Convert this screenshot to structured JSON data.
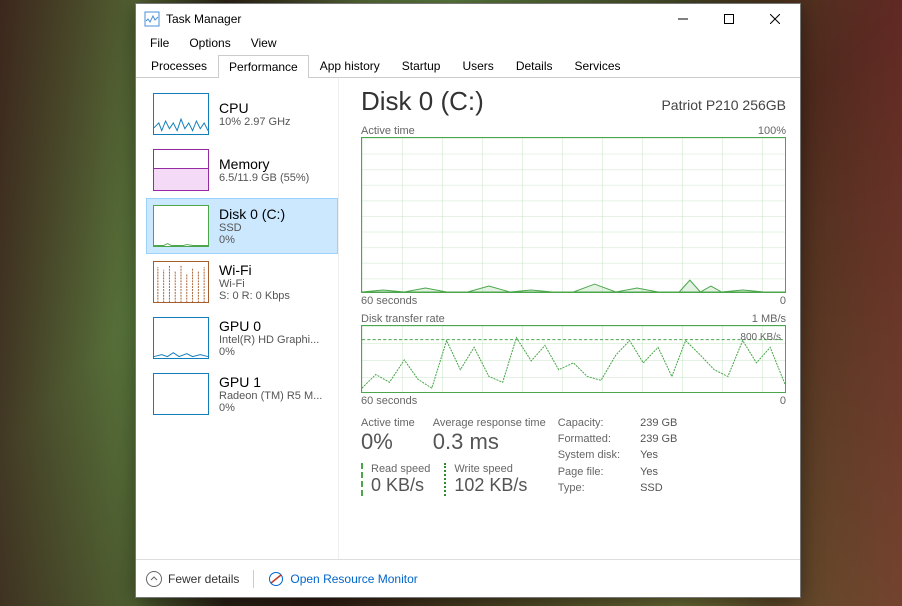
{
  "window": {
    "title": "Task Manager"
  },
  "menus": [
    "File",
    "Options",
    "View"
  ],
  "tabs": [
    "Processes",
    "Performance",
    "App history",
    "Startup",
    "Users",
    "Details",
    "Services"
  ],
  "active_tab": 1,
  "sidebar": {
    "items": [
      {
        "title": "CPU",
        "sub1": "10% 2.97 GHz"
      },
      {
        "title": "Memory",
        "sub1": "6.5/11.9 GB (55%)"
      },
      {
        "title": "Disk 0 (C:)",
        "sub1": "SSD",
        "sub2": "0%"
      },
      {
        "title": "Wi-Fi",
        "sub1": "Wi-Fi",
        "sub2": "S: 0 R: 0 Kbps"
      },
      {
        "title": "GPU 0",
        "sub1": "Intel(R) HD Graphi...",
        "sub2": "0%"
      },
      {
        "title": "GPU 1",
        "sub1": "Radeon (TM) R5 M...",
        "sub2": "0%"
      }
    ],
    "selected": 2
  },
  "main": {
    "title": "Disk 0 (C:)",
    "model": "Patriot P210 256GB",
    "chart1": {
      "label": "Active time",
      "max": "100%",
      "xleft": "60 seconds",
      "xright": "0"
    },
    "chart2": {
      "label": "Disk transfer rate",
      "max": "1 MB/s",
      "maxline": "800 KB/s",
      "xleft": "60 seconds",
      "xright": "0"
    },
    "stats": {
      "active_time": {
        "label": "Active time",
        "value": "0%"
      },
      "resp_time": {
        "label": "Average response time",
        "value": "0.3 ms"
      },
      "read": {
        "label": "Read speed",
        "value": "0 KB/s"
      },
      "write": {
        "label": "Write speed",
        "value": "102 KB/s"
      }
    },
    "info": {
      "Capacity:": "239 GB",
      "Formatted:": "239 GB",
      "System disk:": "Yes",
      "Page file:": "Yes",
      "Type:": "SSD"
    }
  },
  "footer": {
    "fewer": "Fewer details",
    "resmon": "Open Resource Monitor"
  },
  "chart_data": [
    {
      "type": "line",
      "title": "Active time",
      "xlabel": "60 seconds → 0",
      "ylabel": "%",
      "ylim": [
        0,
        100
      ],
      "series": [
        {
          "name": "Active time %",
          "values": [
            0,
            1,
            0,
            2,
            0,
            0,
            3,
            0,
            1,
            0,
            0,
            5,
            0,
            2,
            0,
            0,
            8,
            0,
            3,
            0,
            0,
            1,
            0,
            0,
            6,
            0,
            2,
            0,
            0,
            1
          ]
        }
      ]
    },
    {
      "type": "line",
      "title": "Disk transfer rate",
      "xlabel": "60 seconds → 0",
      "ylabel": "KB/s",
      "ylim": [
        0,
        1000
      ],
      "annotations": [
        "800 KB/s"
      ],
      "series": [
        {
          "name": "Transfer KB/s",
          "values": [
            50,
            200,
            100,
            400,
            150,
            50,
            700,
            300,
            600,
            200,
            100,
            750,
            400,
            650,
            300,
            400,
            200,
            150,
            500,
            700,
            400,
            600,
            200,
            700,
            500,
            300,
            200,
            700,
            400,
            600
          ]
        }
      ]
    }
  ]
}
